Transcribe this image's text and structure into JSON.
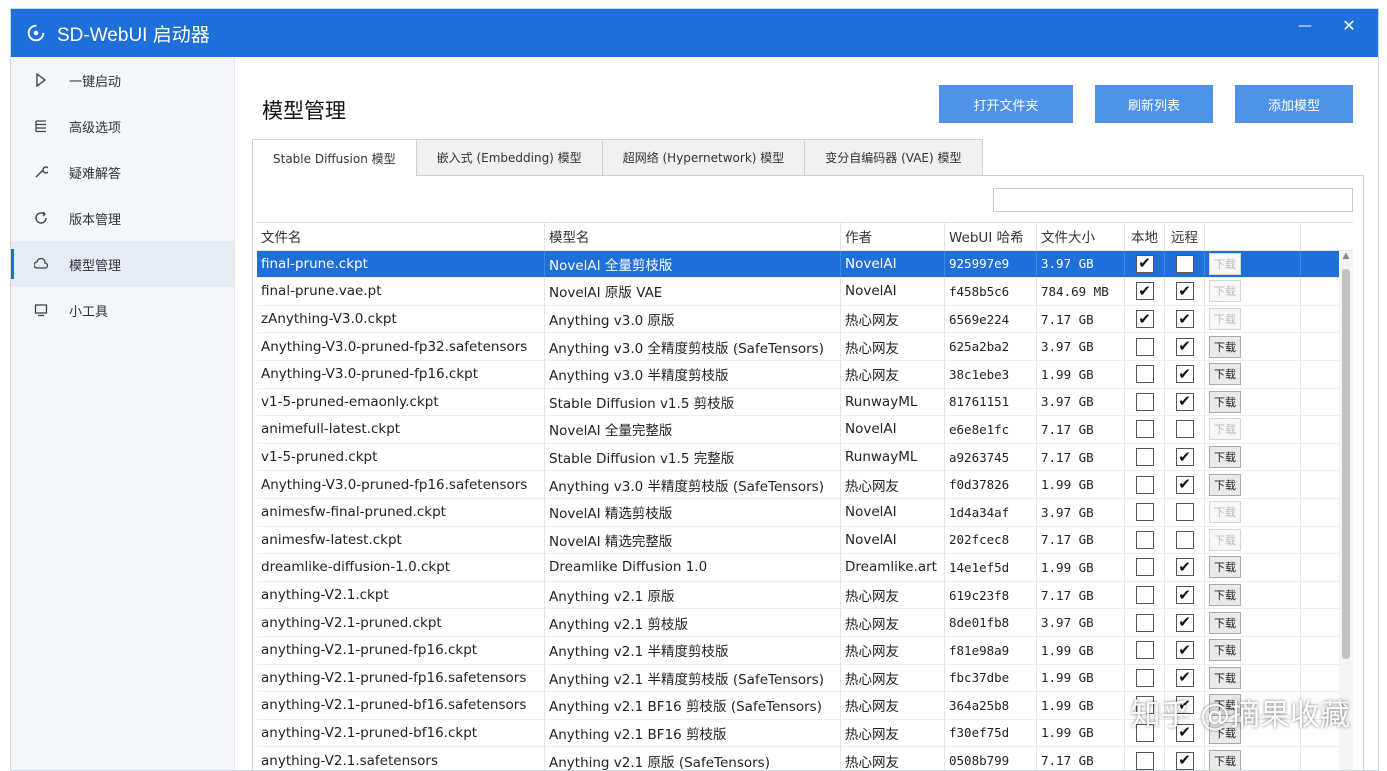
{
  "app": {
    "title": "SD-WebUI 启动器"
  },
  "sidebar": {
    "items": [
      {
        "label": "一键启动",
        "icon": "play-icon"
      },
      {
        "label": "高级选项",
        "icon": "list-icon"
      },
      {
        "label": "疑难解答",
        "icon": "wrench-icon"
      },
      {
        "label": "版本管理",
        "icon": "refresh-icon"
      },
      {
        "label": "模型管理",
        "icon": "cloud-icon",
        "active": true
      },
      {
        "label": "小工具",
        "icon": "tools-icon"
      }
    ]
  },
  "main": {
    "title": "模型管理",
    "buttons": {
      "open_folder": "打开文件夹",
      "refresh_list": "刷新列表",
      "add_model": "添加模型"
    },
    "tabs": [
      "Stable Diffusion 模型",
      "嵌入式 (Embedding) 模型",
      "超网络 (Hypernetwork) 模型",
      "变分自编码器 (VAE) 模型"
    ],
    "search": {
      "value": ""
    },
    "table": {
      "headers": {
        "file": "文件名",
        "model": "模型名",
        "author": "作者",
        "hash": "WebUI 哈希",
        "size": "文件大小",
        "local": "本地",
        "remote": "远程"
      },
      "download_label": "下载",
      "rows": [
        {
          "file": "final-prune.ckpt",
          "model": "NovelAI 全量剪枝版",
          "author": "NovelAI",
          "hash": "925997e9",
          "size": "3.97 GB",
          "local": true,
          "remote": false,
          "dl_enabled": false,
          "selected": true
        },
        {
          "file": "final-prune.vae.pt",
          "model": "NovelAI 原版 VAE",
          "author": "NovelAI",
          "hash": "f458b5c6",
          "size": "784.69 MB",
          "local": true,
          "remote": true,
          "dl_enabled": false
        },
        {
          "file": "zAnything-V3.0.ckpt",
          "model": "Anything v3.0 原版",
          "author": "热心网友",
          "hash": "6569e224",
          "size": "7.17 GB",
          "local": true,
          "remote": true,
          "dl_enabled": false
        },
        {
          "file": "Anything-V3.0-pruned-fp32.safetensors",
          "model": "Anything v3.0 全精度剪枝版 (SafeTensors)",
          "author": "热心网友",
          "hash": "625a2ba2",
          "size": "3.97 GB",
          "local": false,
          "remote": true,
          "dl_enabled": true
        },
        {
          "file": "Anything-V3.0-pruned-fp16.ckpt",
          "model": "Anything v3.0 半精度剪枝版",
          "author": "热心网友",
          "hash": "38c1ebe3",
          "size": "1.99 GB",
          "local": false,
          "remote": true,
          "dl_enabled": true
        },
        {
          "file": "v1-5-pruned-emaonly.ckpt",
          "model": "Stable Diffusion v1.5 剪枝版",
          "author": "RunwayML",
          "hash": "81761151",
          "size": "3.97 GB",
          "local": false,
          "remote": true,
          "dl_enabled": true
        },
        {
          "file": "animefull-latest.ckpt",
          "model": "NovelAI 全量完整版",
          "author": "NovelAI",
          "hash": "e6e8e1fc",
          "size": "7.17 GB",
          "local": false,
          "remote": false,
          "dl_enabled": false
        },
        {
          "file": "v1-5-pruned.ckpt",
          "model": "Stable Diffusion v1.5 完整版",
          "author": "RunwayML",
          "hash": "a9263745",
          "size": "7.17 GB",
          "local": false,
          "remote": true,
          "dl_enabled": true
        },
        {
          "file": "Anything-V3.0-pruned-fp16.safetensors",
          "model": "Anything v3.0 半精度剪枝版 (SafeTensors)",
          "author": "热心网友",
          "hash": "f0d37826",
          "size": "1.99 GB",
          "local": false,
          "remote": true,
          "dl_enabled": true
        },
        {
          "file": "animesfw-final-pruned.ckpt",
          "model": "NovelAI 精选剪枝版",
          "author": "NovelAI",
          "hash": "1d4a34af",
          "size": "3.97 GB",
          "local": false,
          "remote": false,
          "dl_enabled": false
        },
        {
          "file": "animesfw-latest.ckpt",
          "model": "NovelAI 精选完整版",
          "author": "NovelAI",
          "hash": "202fcec8",
          "size": "7.17 GB",
          "local": false,
          "remote": false,
          "dl_enabled": false
        },
        {
          "file": "dreamlike-diffusion-1.0.ckpt",
          "model": "Dreamlike Diffusion 1.0",
          "author": "Dreamlike.art",
          "hash": "14e1ef5d",
          "size": "1.99 GB",
          "local": false,
          "remote": true,
          "dl_enabled": true
        },
        {
          "file": "anything-V2.1.ckpt",
          "model": "Anything v2.1 原版",
          "author": "热心网友",
          "hash": "619c23f8",
          "size": "7.17 GB",
          "local": false,
          "remote": true,
          "dl_enabled": true
        },
        {
          "file": "anything-V2.1-pruned.ckpt",
          "model": "Anything v2.1 剪枝版",
          "author": "热心网友",
          "hash": "8de01fb8",
          "size": "3.97 GB",
          "local": false,
          "remote": true,
          "dl_enabled": true
        },
        {
          "file": "anything-V2.1-pruned-fp16.ckpt",
          "model": "Anything v2.1 半精度剪枝版",
          "author": "热心网友",
          "hash": "f81e98a9",
          "size": "1.99 GB",
          "local": false,
          "remote": true,
          "dl_enabled": true
        },
        {
          "file": "anything-V2.1-pruned-fp16.safetensors",
          "model": "Anything v2.1 半精度剪枝版 (SafeTensors)",
          "author": "热心网友",
          "hash": "fbc37dbe",
          "size": "1.99 GB",
          "local": false,
          "remote": true,
          "dl_enabled": true
        },
        {
          "file": "anything-V2.1-pruned-bf16.safetensors",
          "model": "Anything v2.1 BF16 剪枝版 (SafeTensors)",
          "author": "热心网友",
          "hash": "364a25b8",
          "size": "1.99 GB",
          "local": false,
          "remote": true,
          "dl_enabled": true
        },
        {
          "file": "anything-V2.1-pruned-bf16.ckpt",
          "model": "Anything v2.1 BF16 剪枝版",
          "author": "热心网友",
          "hash": "f30ef75d",
          "size": "1.99 GB",
          "local": false,
          "remote": true,
          "dl_enabled": true
        },
        {
          "file": "anything-V2.1.safetensors",
          "model": "Anything v2.1 原版 (SafeTensors)",
          "author": "热心网友",
          "hash": "0508b799",
          "size": "7.17 GB",
          "local": false,
          "remote": true,
          "dl_enabled": true
        }
      ]
    }
  },
  "watermark": "知乎 @摘果收藏",
  "colors": {
    "accent": "#1e6fd9",
    "button": "#4d93e8"
  }
}
